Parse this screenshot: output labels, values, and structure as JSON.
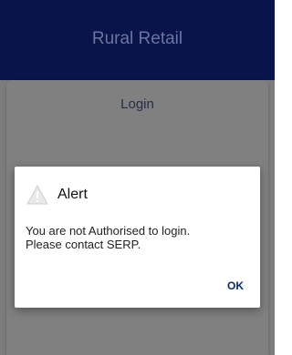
{
  "app": {
    "title": "Rural Retail"
  },
  "login": {
    "title": "Login"
  },
  "alert": {
    "icon": "warning-icon",
    "title": "Alert",
    "message_line1": "You are not Authorised to login.",
    "message_line2": "Please contact SERP.",
    "ok_label": "OK"
  },
  "colors": {
    "app_bar": "#08144a",
    "overlay": "#7d7d7d",
    "ok_text": "#0a2a6a"
  }
}
